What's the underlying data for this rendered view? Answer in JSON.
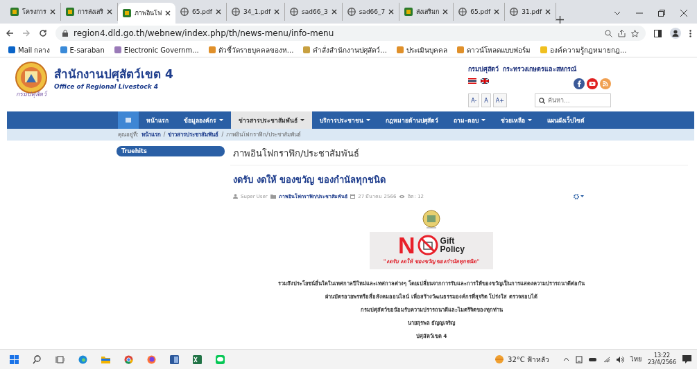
{
  "browser": {
    "tabs": [
      {
        "title": "โครงการ",
        "kind": "site",
        "selected": false
      },
      {
        "title": "การส่งเสริ",
        "kind": "site",
        "selected": false
      },
      {
        "title": "ภาพอินโฟ",
        "kind": "site",
        "selected": true
      },
      {
        "title": "65.pdf",
        "kind": "pdf",
        "selected": false
      },
      {
        "title": "34_1.pdf",
        "kind": "pdf",
        "selected": false
      },
      {
        "title": "sad66_3",
        "kind": "pdf",
        "selected": false
      },
      {
        "title": "sad66_7",
        "kind": "pdf",
        "selected": false
      },
      {
        "title": "ส่งเสริมก",
        "kind": "site",
        "selected": false
      },
      {
        "title": "65.pdf",
        "kind": "pdf",
        "selected": false
      },
      {
        "title": "31.pdf",
        "kind": "pdf",
        "selected": false
      }
    ],
    "url": "region4.dld.go.th/webnew/index.php/th/news-menu/info-menu",
    "bookmarks": [
      {
        "label": "Mail กลาง",
        "color": "#0a64c8"
      },
      {
        "label": "E-saraban",
        "color": "#3a8ad8"
      },
      {
        "label": "Electronic Governm...",
        "color": "#9a7ab8"
      },
      {
        "label": "ตัวชี้วัดรายบุคคลของห...",
        "color": "#e0902a"
      },
      {
        "label": "คำสั่งสำนักงานปศุสัตว์...",
        "color": "#c8a040"
      },
      {
        "label": "ประเมินบุคคล",
        "color": "#e0902a"
      },
      {
        "label": "ดาวน์โหลดแบบฟอร์ม",
        "color": "#e0902a"
      },
      {
        "label": "องค์ความรู้กฎหมายกฎ...",
        "color": "#f0c020"
      }
    ]
  },
  "site": {
    "title": "สำนักงานปศุสัตว์เขต 4",
    "subtitle": "Office of Regional Livestock 4",
    "logo_caption": "กรมปศุสัตว์",
    "dept_links": [
      "กรมปศุสัตว์",
      "กระทรวงเกษตรและสหกรณ์"
    ],
    "font_sizes": [
      "A-",
      "A",
      "A+"
    ],
    "search": {
      "placeholder": "ค้นหา..."
    }
  },
  "nav": [
    {
      "label": "หน้าแรก",
      "dropdown": false,
      "selected": false
    },
    {
      "label": "ข้อมูลองค์กร",
      "dropdown": true,
      "selected": false
    },
    {
      "label": "ข่าวสารประชาสัมพันธ์",
      "dropdown": true,
      "selected": true
    },
    {
      "label": "บริการประชาชน",
      "dropdown": true,
      "selected": false
    },
    {
      "label": "กฎหมายด้านปศุสัตว์",
      "dropdown": false,
      "selected": false
    },
    {
      "label": "ถาม-ตอบ",
      "dropdown": true,
      "selected": false
    },
    {
      "label": "ช่วยเหลือ",
      "dropdown": true,
      "selected": false
    },
    {
      "label": "แผนผังเว็บไซต์",
      "dropdown": false,
      "selected": false
    }
  ],
  "breadcrumb": {
    "prefix": "คุณอยู่ที่:",
    "separator": "/",
    "items": [
      "หน้าแรก",
      "ข่าวสารประชาสัมพันธ์",
      "ภาพอินโฟกราฟิก/ประชาสัมพันธ์"
    ]
  },
  "sidebar": {
    "module_title": "Truehits"
  },
  "page_heading": "ภาพอินโฟกราฟิก/ประชาสัมพันธ์",
  "article": {
    "title": "งดรับ งดให้ ของขวัญ ของกำนัลทุกชนิด",
    "author": "Super User",
    "category": "ภาพอินโฟกราฟิก/ประชาสัมพันธ์",
    "date": "27 มีนาคม 2566",
    "hits": "ฮิต: 12",
    "banner": {
      "big_letter": "N",
      "lines": [
        "Gift",
        "Policy"
      ],
      "caption": "\"งดรับ งดให้ ของขวัญ ของกำนัลทุกชนิด\""
    },
    "body": [
      "รวมถึงประโยชน์อื่นใดในเทศกาลปีใหม่และเทศกาลต่างๆ โดยเปลี่ยนจากการรับและการให้ของขวัญเป็นการแสดงความปรารถนาดีต่อกัน",
      "ผ่านบัตรอวยพรหรือสื่อสังคมออนไลน์ เพื่อสร้างวัฒนธรรมองค์กรที่สุจริต โปร่งใส ตรวจสอบได้",
      "กรมปศุสัตว์ขอน้อมรับความปรารถนาดีและไมตรีจิตของทุกท่าน",
      "นายสุรพล ธัญญเจริญ",
      "ปศุสัตว์เขต 4"
    ]
  },
  "taskbar": {
    "weather": "32°C ฟ้าหลัว",
    "language": "ไทย",
    "time": "13:22",
    "date": "23/4/2566"
  }
}
